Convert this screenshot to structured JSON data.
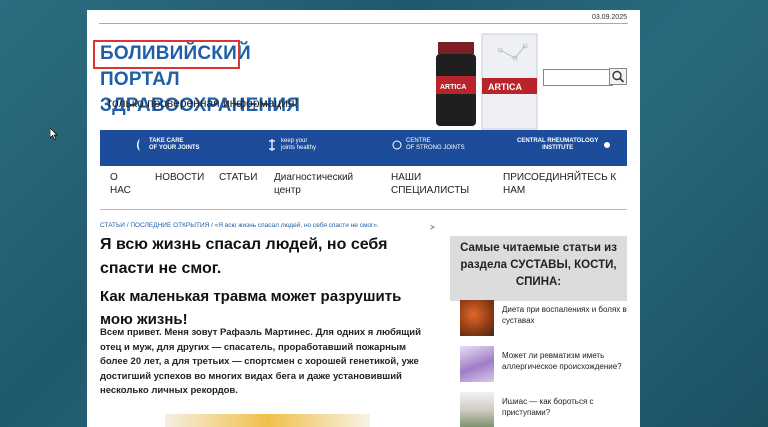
{
  "header": {
    "date": "03.09.2025",
    "title_line1_highlight": "БОЛИВИЙСКИЙ",
    "title_line1_rest": " ПОРТАЛ",
    "title_line2": "ЗДРАВООХРАНЕНИЯ",
    "tagline": ": только проверенная информация!"
  },
  "ad": {
    "product_name": "ARTICA",
    "accent_color": "#b8242c"
  },
  "search": {
    "placeholder": "",
    "button_icon": "search-icon"
  },
  "banner": {
    "color": "#1d4c9a",
    "items": [
      {
        "line1": "TAKE CARE",
        "line2": "OF YOUR JOINTS"
      },
      {
        "line1": "keep your",
        "line2": "joints healthy"
      },
      {
        "line1": "CENTRE",
        "line2": "OF STRONG JOINTS"
      },
      {
        "line1": "CENTRAL RHEUMATOLOGY",
        "line2": "INSTITUTE"
      }
    ]
  },
  "nav": {
    "items": [
      {
        "label_line1": "О",
        "label_line2": "НАС"
      },
      {
        "label_line1": "НОВОСТИ",
        "label_line2": ""
      },
      {
        "label_line1": "СТАТЬИ",
        "label_line2": ""
      },
      {
        "label_line1": "Диагностический",
        "label_line2": "центр"
      },
      {
        "label_line1": "НАШИ",
        "label_line2": "СПЕЦИАЛИСТЫ"
      },
      {
        "label_line1": "ПРИСОЕДИНЯЙТЕСЬ К",
        "label_line2": "НАМ"
      }
    ]
  },
  "breadcrumb": "СТАТЬИ / ПОСЛЕДНИЕ ОТКРЫТИЯ / «Я всю жизнь спасал людей, но себя спасти не смог».",
  "article": {
    "title": "Я всю жизнь спасал людей, но себя спасти не смог.",
    "subtitle": "Как маленькая травма может разрушить мою жизнь!",
    "body": "Всем привет. Меня зовут Рафаэль Мартинес. Для одних я любящий отец и муж, для других — спасатель, проработавший пожарным более 20 лет, а для третьих — спортсмен с хорошей генетикой, уже достигший успехов во многих видах бега и даже установивший несколько личных рекордов."
  },
  "sidebar": {
    "header": "Самые читаемые статьи из раздела СУСТАВЫ, КОСТИ, СПИНА:",
    "items": [
      {
        "text": "Диета при воспалениях и болях в суставах"
      },
      {
        "text": "Может ли ревматизм иметь аллергическое происхождение?"
      },
      {
        "text": "Ишиас — как бороться с приступами?"
      }
    ]
  }
}
